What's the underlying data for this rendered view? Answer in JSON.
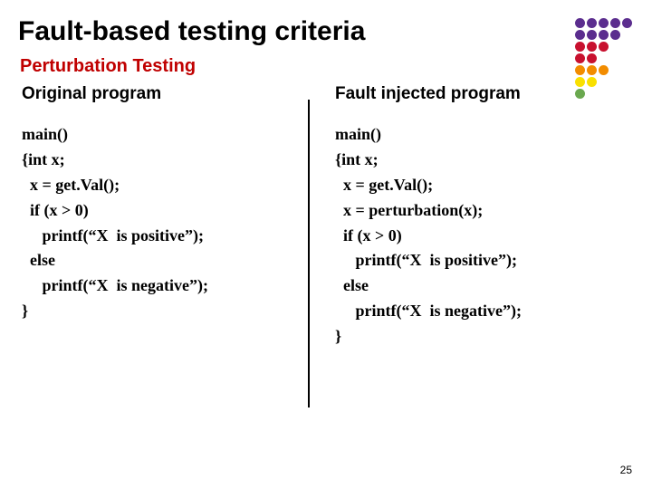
{
  "title": "Fault-based testing criteria",
  "subtitle": "Perturbation Testing",
  "left": {
    "header": "Original program",
    "code": "main()\n{int x;\n  x = get.Val();\n  if (x > 0)\n     printf(“X  is positive”);\n  else\n     printf(“X  is negative”);\n}"
  },
  "right": {
    "header": "Fault injected program",
    "code": "main()\n{int x;\n  x = get.Val();\n  x = perturbation(x);\n  if (x > 0)\n     printf(“X  is positive”);\n  else\n     printf(“X  is negative”);\n}"
  },
  "page_number": "25",
  "dot_colors": {
    "purple": "#5b2d8e",
    "red": "#c8102e",
    "orange": "#f28c00",
    "yellow": "#f9e000",
    "green": "#6aa84f"
  },
  "dot_grid": [
    [
      "purple",
      "purple",
      "purple",
      "purple",
      "purple"
    ],
    [
      "purple",
      "purple",
      "purple",
      "purple",
      ""
    ],
    [
      "red",
      "red",
      "red",
      "",
      ""
    ],
    [
      "red",
      "red",
      "",
      "",
      ""
    ],
    [
      "orange",
      "orange",
      "orange",
      "",
      ""
    ],
    [
      "yellow",
      "yellow",
      "",
      "",
      ""
    ],
    [
      "green",
      "",
      "",
      "",
      ""
    ]
  ]
}
